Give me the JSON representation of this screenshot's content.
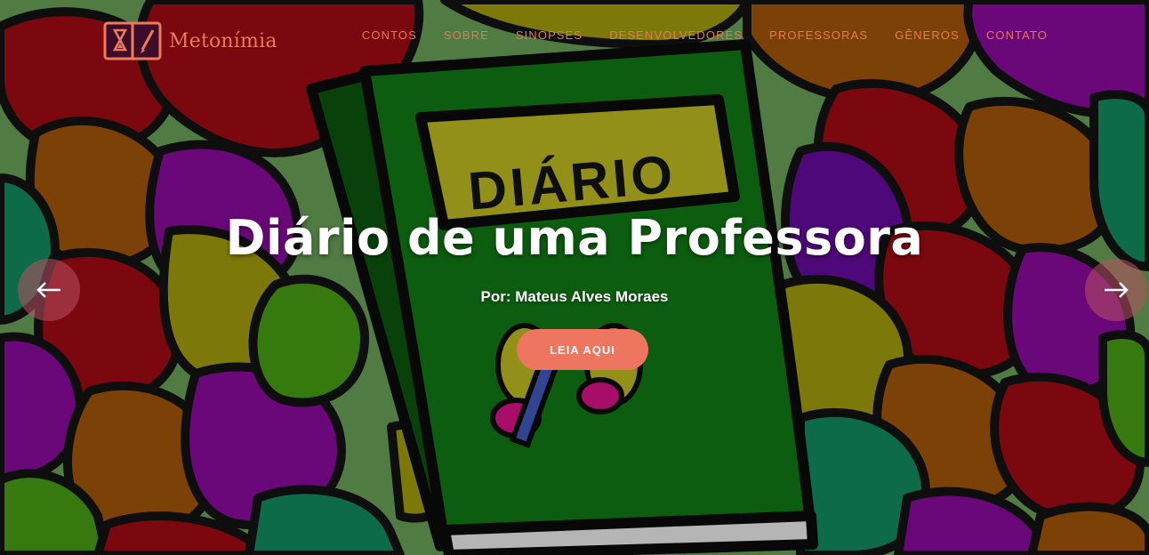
{
  "brand": {
    "name": "Metonímia",
    "logo_icon": "open-book-hourglass-pen-icon"
  },
  "nav": {
    "items": [
      {
        "label": "CONTOS"
      },
      {
        "label": "SOBRE"
      },
      {
        "label": "SINOPSES"
      },
      {
        "label": "DESENVOLVEDORES"
      },
      {
        "label": "PROFESSORAS"
      },
      {
        "label": "GÊNEROS"
      },
      {
        "label": "CONTATO"
      }
    ]
  },
  "hero": {
    "title": "Diário de uma Professora",
    "author": "Por: Mateus Alves Moraes",
    "button_label": "LEIA AQUI",
    "book_cover_text": "DIÁRIO",
    "prev_icon": "arrow-left-icon",
    "next_icon": "arrow-right-icon"
  },
  "colors": {
    "accent": "#ee7560",
    "nav_text": "#e67a57",
    "book_green": "#0e6a12",
    "label_yellow": "#a7a41c"
  }
}
